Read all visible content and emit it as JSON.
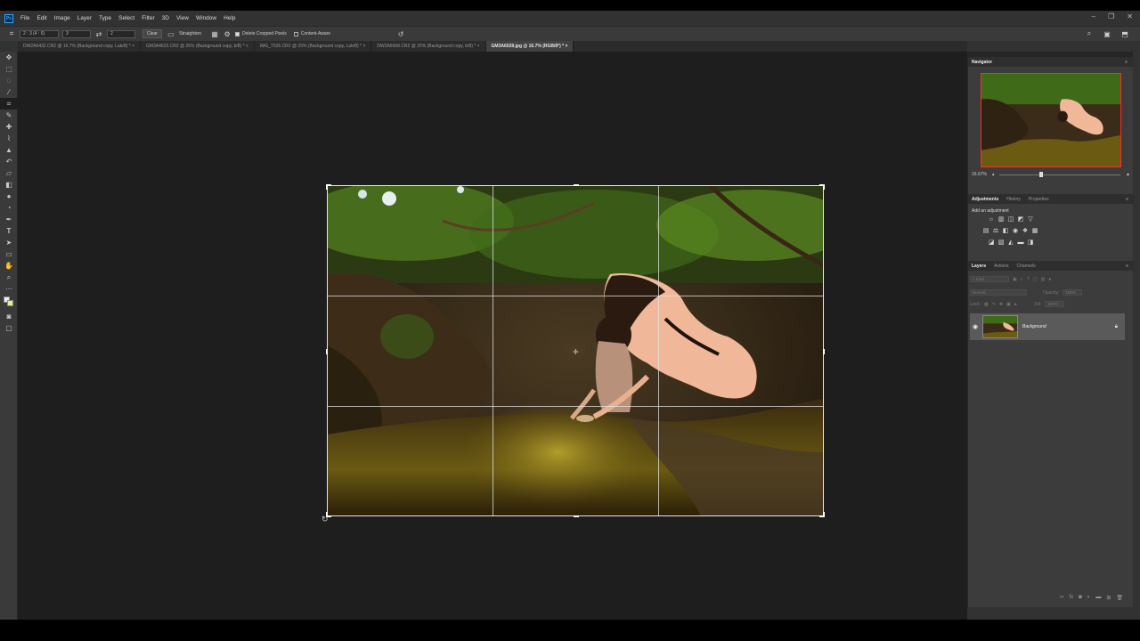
{
  "app": {
    "logo": "Ps",
    "menu": [
      "File",
      "Edit",
      "Image",
      "Layer",
      "Type",
      "Select",
      "Filter",
      "3D",
      "View",
      "Window",
      "Help"
    ],
    "window_controls": [
      "–",
      "❐",
      "✕"
    ]
  },
  "options_bar": {
    "ratio_preset": "2 : 3 (4 : 6)",
    "width": "3",
    "height": "2",
    "clear_label": "Clear",
    "straighten_label": "Straighten",
    "delete_cropped_label": "Delete Cropped Pixels",
    "delete_cropped_checked": true,
    "content_aware_label": "Content-Aware",
    "content_aware_checked": false
  },
  "tabs": [
    {
      "label": "DW2A6432.CR2 @ 16.7% (Background copy, Lab/8) *",
      "active": false
    },
    {
      "label": "GM3A4623.CR2 @ 25% (Background copy, b/8) *",
      "active": false
    },
    {
      "label": "IMG_7526.CR2 @ 25% (Background copy, Lab/8) *",
      "active": false
    },
    {
      "label": "DW2A6668.CR2 @ 25% (Background copy, b/8) *",
      "active": false
    },
    {
      "label": "GM3A6028.jpg @ 16.7% (RGB/8*) *",
      "active": true
    }
  ],
  "tab_close": "×",
  "tools": [
    "move-icon",
    "marquee-icon",
    "lasso-icon",
    "magic-wand-icon",
    "crop-icon",
    "eyedropper-icon",
    "healing-icon",
    "brush-icon",
    "stamp-icon",
    "history-brush-icon",
    "eraser-icon",
    "gradient-icon",
    "blur-icon",
    "dodge-icon",
    "pen-icon",
    "type-icon",
    "path-select-icon",
    "rectangle-icon",
    "hand-icon",
    "zoom-icon",
    "more-icon"
  ],
  "navigator": {
    "title": "Navigator",
    "zoom": "16.67%",
    "zoom_slider_fraction": 0.33
  },
  "adjustments": {
    "tabs": [
      "Adjustments",
      "History",
      "Properties"
    ],
    "heading": "Add an adjustment"
  },
  "layers": {
    "tabs": [
      "Layers",
      "Actions",
      "Channels"
    ],
    "kind_placeholder": "Kind",
    "blend_mode": "Normal",
    "opacity_label": "Opacity:",
    "opacity_value": "100%",
    "lock_label": "Lock:",
    "fill_label": "Fill:",
    "fill_value": "100%",
    "layer_name": "Background",
    "footer_icons": [
      "link-icon",
      "fx-icon",
      "mask-icon",
      "adjustment-icon",
      "group-icon",
      "new-layer-icon",
      "trash-icon"
    ]
  },
  "colors": {
    "accent": "#31a8ff",
    "nav_frame": "#ff2a2a"
  }
}
